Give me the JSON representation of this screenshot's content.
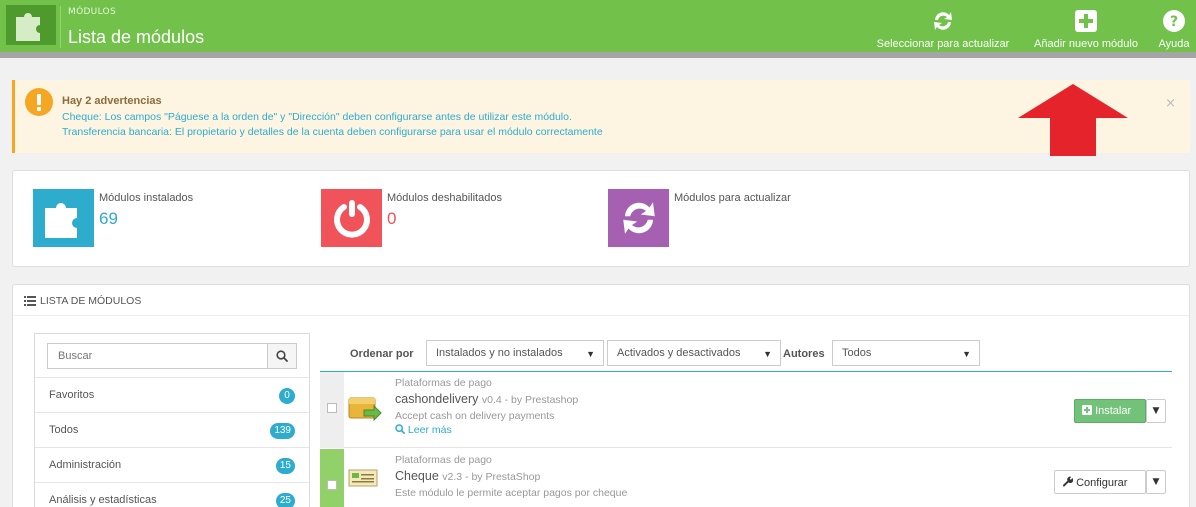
{
  "header": {
    "breadcrumb": "MÓDULOS",
    "title": "Lista de módulos",
    "buttons": {
      "check_update": "Seleccionar para actualizar",
      "add_module": "Añadir nuevo módulo",
      "help": "Ayuda"
    }
  },
  "warning": {
    "title": "Hay 2 advertencias",
    "lines": [
      "Cheque: Los campos \"Páguese a la orden de\" y \"Dirección\" deben configurarse antes de utilizar este módulo.",
      "Transferencia bancaria: El propietario y detalles de la cuenta deben configurarse para usar el módulo correctamente"
    ],
    "close": "×"
  },
  "stats": [
    {
      "label": "Módulos instalados",
      "value": "69",
      "color": "#2eacce",
      "icon": "puzzle-icon"
    },
    {
      "label": "Módulos deshabilitados",
      "value": "0",
      "color": "#f0535a",
      "icon": "power-icon"
    },
    {
      "label": "Módulos para actualizar",
      "value": "",
      "color": "#a560b2",
      "icon": "refresh-icon"
    }
  ],
  "panel": {
    "title": "Lista de módulos"
  },
  "filters": {
    "search_placeholder": "Buscar",
    "categories": [
      {
        "label": "Favoritos",
        "count": "0"
      },
      {
        "label": "Todos",
        "count": "139"
      },
      {
        "label": "Administración",
        "count": "15"
      },
      {
        "label": "Análisis y estadísticas",
        "count": "25"
      }
    ]
  },
  "sort": {
    "order_label": "Ordenar por",
    "install_filter": "Instalados y no instalados",
    "status_filter": "Activados y desactivados",
    "authors_label": "Autores",
    "authors_filter": "Todos"
  },
  "modules": [
    {
      "category": "Plataformas de pago",
      "name": "cashondelivery",
      "version": "v0.4 - by Prestashop",
      "description": "Accept cash on delivery payments",
      "more": "Leer más",
      "action": "Instalar",
      "icon": "cash-delivery-icon"
    },
    {
      "category": "Plataformas de pago",
      "name": "Cheque",
      "version": "v2.3 - by PrestaShop",
      "description": "Este módulo le permite aceptar pagos por cheque",
      "action": "Configurar",
      "icon": "cheque-icon"
    }
  ],
  "colors": {
    "header_green": "#71c14a",
    "accent_blue": "#2eacce",
    "warning_bg": "#fdf4e2",
    "arrow_red": "#e5232a"
  }
}
